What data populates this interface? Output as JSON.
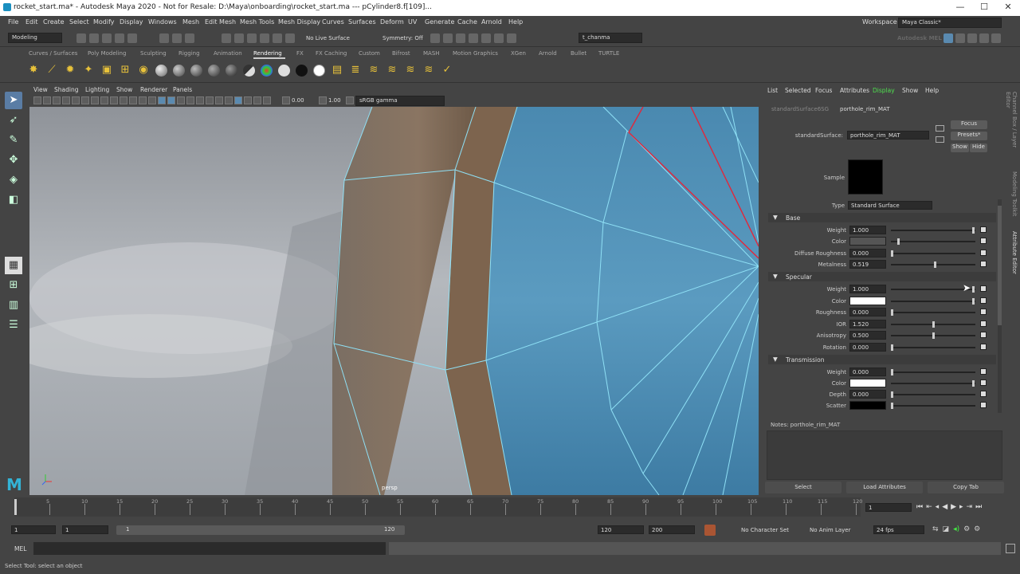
{
  "window": {
    "title": "rocket_start.ma* - Autodesk Maya 2020 - Not for Resale: D:\\Maya\\onboarding\\rocket_start.ma  ---  pCylinder8.f[109]...",
    "min": "—",
    "max": "☐",
    "close": "✕"
  },
  "menu": [
    "File",
    "Edit",
    "Create",
    "Select",
    "Modify",
    "Display",
    "Windows",
    "Mesh",
    "Edit Mesh",
    "Mesh Tools",
    "Mesh Display",
    "Curves",
    "Surfaces",
    "Deform",
    "UV",
    "Generate",
    "Cache",
    "Arnold",
    "Help"
  ],
  "workspace": {
    "label": "Workspace :",
    "value": "Maya Classic*"
  },
  "status": {
    "mode": "Modeling",
    "live": "No Live Surface",
    "symmetry": "Symmetry: Off",
    "user": "t_chanma",
    "mel_logo": "Autodesk MEL"
  },
  "shelf_tabs": [
    "Curves / Surfaces",
    "Poly Modeling",
    "Sculpting",
    "Rigging",
    "Animation",
    "Rendering",
    "FX",
    "FX Caching",
    "Custom",
    "Bifrost",
    "MASH",
    "Motion Graphics",
    "XGen",
    "Arnold",
    "Bullet",
    "TURTLE"
  ],
  "shelf_active": "Rendering",
  "viewport": {
    "menu": [
      "View",
      "Shading",
      "Lighting",
      "Show",
      "Renderer",
      "Panels"
    ],
    "exposure": "0.00",
    "gamma": "1.00",
    "colorspace": "sRGB gamma",
    "camera": "persp"
  },
  "panel": {
    "menu": [
      "List",
      "Selected",
      "Focus",
      "Attributes",
      "Display",
      "Show",
      "Help"
    ],
    "tabs": [
      "standardSurface6SG",
      "porthole_rim_MAT"
    ],
    "node_label": "standardSurface:",
    "node_value": "porthole_rim_MAT",
    "focus": "Focus",
    "presets": "Presets*",
    "show": "Show",
    "hide": "Hide",
    "sample_label": "Sample",
    "type_label": "Type",
    "type_value": "Standard Surface",
    "side_tabs": [
      "Channel Box / Layer Editor",
      "Modeling Toolkit",
      "Attribute Editor"
    ]
  },
  "base": {
    "title": "Base",
    "rows": [
      {
        "label": "Weight",
        "value": "1.000",
        "t": 0.99
      },
      {
        "label": "Color",
        "value": "",
        "t": 0.08
      },
      {
        "label": "Diffuse Roughness",
        "value": "0.000",
        "t": 0.0
      },
      {
        "label": "Metalness",
        "value": "0.519",
        "t": 0.52
      }
    ]
  },
  "specular": {
    "title": "Specular",
    "rows": [
      {
        "label": "Weight",
        "value": "1.000",
        "t": 0.99
      },
      {
        "label": "Color",
        "value": "",
        "t": 0.99
      },
      {
        "label": "Roughness",
        "value": "0.000",
        "t": 0.0
      },
      {
        "label": "IOR",
        "value": "1.520",
        "t": 0.5
      },
      {
        "label": "Anisotropy",
        "value": "0.500",
        "t": 0.5
      },
      {
        "label": "Rotation",
        "value": "0.000",
        "t": 0.0
      }
    ]
  },
  "transmission": {
    "title": "Transmission",
    "rows": [
      {
        "label": "Weight",
        "value": "0.000",
        "t": 0.0
      },
      {
        "label": "Color",
        "value": "",
        "t": 0.99
      },
      {
        "label": "Depth",
        "value": "0.000",
        "t": 0.0
      },
      {
        "label": "Scatter",
        "value": "",
        "t": 0.0
      }
    ]
  },
  "notes": "Notes:  porthole_rim_MAT",
  "bottom_buttons": [
    "Select",
    "Load Attributes",
    "Copy Tab"
  ],
  "timeline": {
    "ticks": [
      "5",
      "10",
      "15",
      "20",
      "25",
      "30",
      "35",
      "40",
      "45",
      "50",
      "55",
      "60",
      "65",
      "70",
      "75",
      "80",
      "85",
      "90",
      "95",
      "100",
      "105",
      "110",
      "115",
      "120"
    ],
    "current": "1"
  },
  "range": {
    "start": "1",
    "start2": "1",
    "slider_start": "1",
    "slider_end": "120",
    "end": "120",
    "end2": "200",
    "char_set": "No Character Set",
    "anim_layer": "No Anim Layer",
    "fps": "24 fps"
  },
  "mel": {
    "label": "MEL"
  },
  "help": "Select Tool: select an object"
}
